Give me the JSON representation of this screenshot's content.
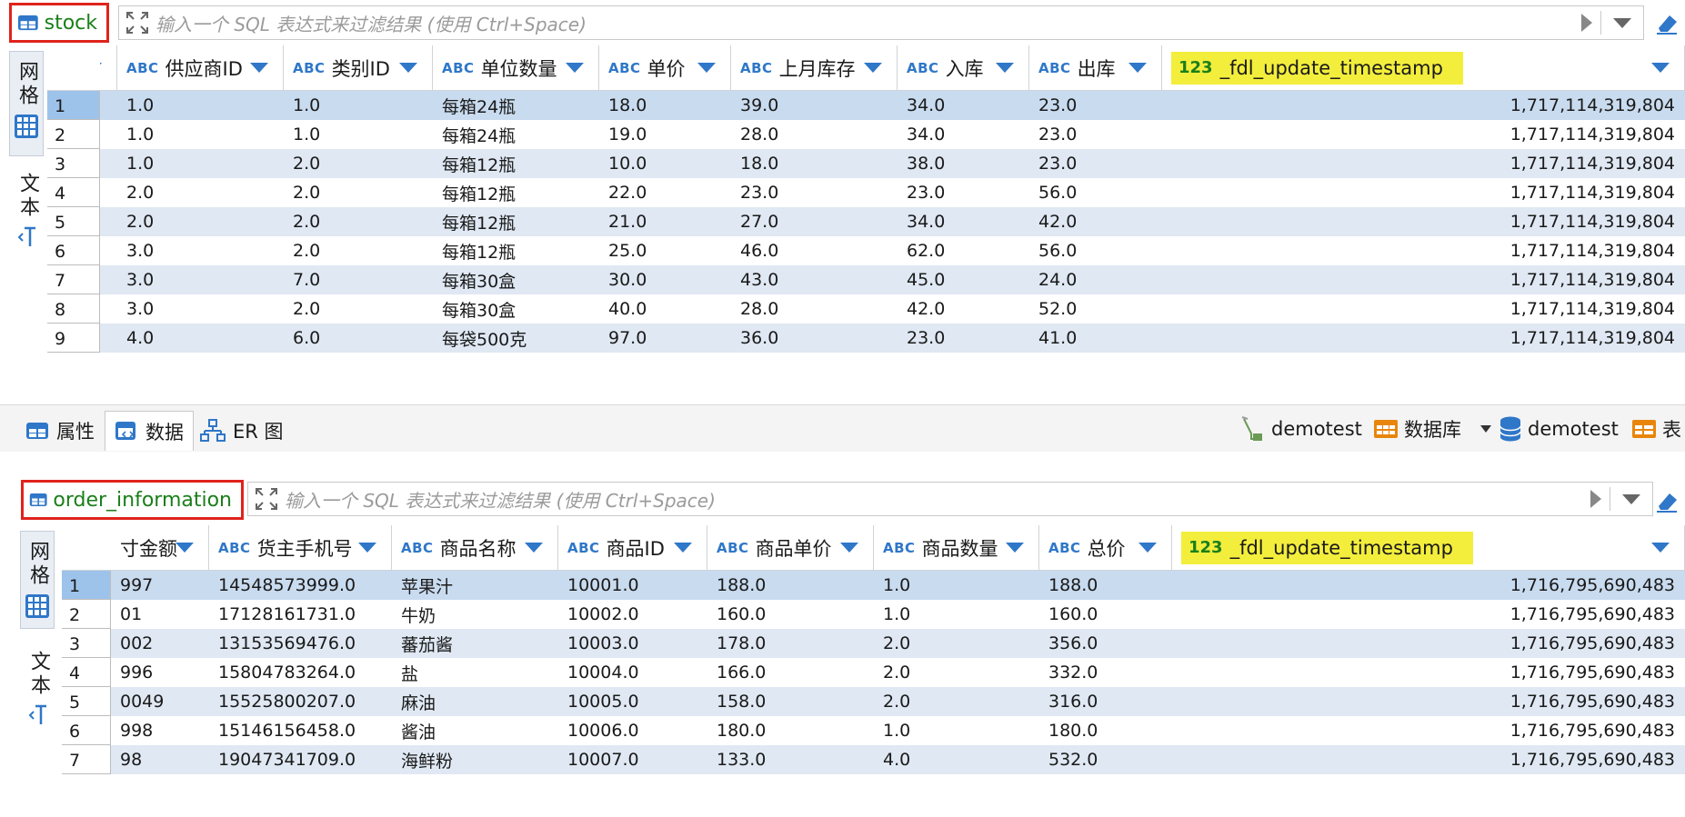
{
  "filter_placeholder": "输入一个 SQL 表达式来过滤结果 (使用 Ctrl+Space)",
  "side_tabs": {
    "grid": "网格",
    "text": "文本"
  },
  "top": {
    "table_name": "stock",
    "columns": [
      {
        "type": "",
        "label": ""
      },
      {
        "type": "ABC",
        "label": "供应商ID"
      },
      {
        "type": "ABC",
        "label": "类别ID"
      },
      {
        "type": "ABC",
        "label": "单位数量"
      },
      {
        "type": "ABC",
        "label": "单价"
      },
      {
        "type": "ABC",
        "label": "上月库存"
      },
      {
        "type": "ABC",
        "label": "入库"
      },
      {
        "type": "ABC",
        "label": "出库"
      },
      {
        "type": "123",
        "label": "_fdl_update_timestamp"
      }
    ],
    "rows": [
      {
        "n": "1",
        "c": [
          "",
          "1.0",
          "1.0",
          "每箱24瓶",
          "18.0",
          "39.0",
          "34.0",
          "23.0",
          "1,717,114,319,804"
        ]
      },
      {
        "n": "2",
        "c": [
          "",
          "1.0",
          "1.0",
          "每箱24瓶",
          "19.0",
          "28.0",
          "34.0",
          "23.0",
          "1,717,114,319,804"
        ]
      },
      {
        "n": "3",
        "c": [
          "",
          "1.0",
          "2.0",
          "每箱12瓶",
          "10.0",
          "18.0",
          "38.0",
          "23.0",
          "1,717,114,319,804"
        ]
      },
      {
        "n": "4",
        "c": [
          "",
          "2.0",
          "2.0",
          "每箱12瓶",
          "22.0",
          "23.0",
          "23.0",
          "56.0",
          "1,717,114,319,804"
        ]
      },
      {
        "n": "5",
        "c": [
          "",
          "2.0",
          "2.0",
          "每箱12瓶",
          "21.0",
          "27.0",
          "34.0",
          "42.0",
          "1,717,114,319,804"
        ]
      },
      {
        "n": "6",
        "c": [
          "",
          "3.0",
          "2.0",
          "每箱12瓶",
          "25.0",
          "46.0",
          "62.0",
          "56.0",
          "1,717,114,319,804"
        ]
      },
      {
        "n": "7",
        "c": [
          "",
          "3.0",
          "7.0",
          "每箱30盒",
          "30.0",
          "43.0",
          "45.0",
          "24.0",
          "1,717,114,319,804"
        ]
      },
      {
        "n": "8",
        "c": [
          "",
          "3.0",
          "2.0",
          "每箱30盒",
          "40.0",
          "28.0",
          "42.0",
          "52.0",
          "1,717,114,319,804"
        ]
      },
      {
        "n": "9",
        "c": [
          "",
          "4.0",
          "6.0",
          "每袋500克",
          "97.0",
          "36.0",
          "23.0",
          "41.0",
          "1,717,114,319,804"
        ]
      }
    ]
  },
  "midbar": {
    "tabs": [
      "属性",
      "数据",
      "ER 图"
    ],
    "connection": "demotest",
    "database_label": "数据库",
    "schema": "demotest",
    "table_label": "表"
  },
  "bottom": {
    "table_name": "order_information",
    "columns": [
      {
        "type": "",
        "label": "寸金额"
      },
      {
        "type": "ABC",
        "label": "货主手机号"
      },
      {
        "type": "ABC",
        "label": "商品名称"
      },
      {
        "type": "ABC",
        "label": "商品ID"
      },
      {
        "type": "ABC",
        "label": "商品单价"
      },
      {
        "type": "ABC",
        "label": "商品数量"
      },
      {
        "type": "ABC",
        "label": "总价"
      },
      {
        "type": "123",
        "label": "_fdl_update_timestamp"
      }
    ],
    "rows": [
      {
        "n": "1",
        "c": [
          "997",
          "14548573999.0",
          "苹果汁",
          "10001.0",
          "188.0",
          "1.0",
          "188.0",
          "1,716,795,690,483"
        ]
      },
      {
        "n": "2",
        "c": [
          "01",
          "17128161731.0",
          "牛奶",
          "10002.0",
          "160.0",
          "1.0",
          "160.0",
          "1,716,795,690,483"
        ]
      },
      {
        "n": "3",
        "c": [
          "002",
          "13153569476.0",
          "蕃茄酱",
          "10003.0",
          "178.0",
          "2.0",
          "356.0",
          "1,716,795,690,483"
        ]
      },
      {
        "n": "4",
        "c": [
          "996",
          "15804783264.0",
          "盐",
          "10004.0",
          "166.0",
          "2.0",
          "332.0",
          "1,716,795,690,483"
        ]
      },
      {
        "n": "5",
        "c": [
          "0049",
          "15525800207.0",
          "麻油",
          "10005.0",
          "158.0",
          "2.0",
          "316.0",
          "1,716,795,690,483"
        ]
      },
      {
        "n": "6",
        "c": [
          "998",
          "15146156458.0",
          "酱油",
          "10006.0",
          "180.0",
          "1.0",
          "180.0",
          "1,716,795,690,483"
        ]
      },
      {
        "n": "7",
        "c": [
          "98",
          "19047341709.0",
          "海鲜粉",
          "10007.0",
          "133.0",
          "4.0",
          "532.0",
          "1,716,795,690,483"
        ]
      }
    ]
  }
}
